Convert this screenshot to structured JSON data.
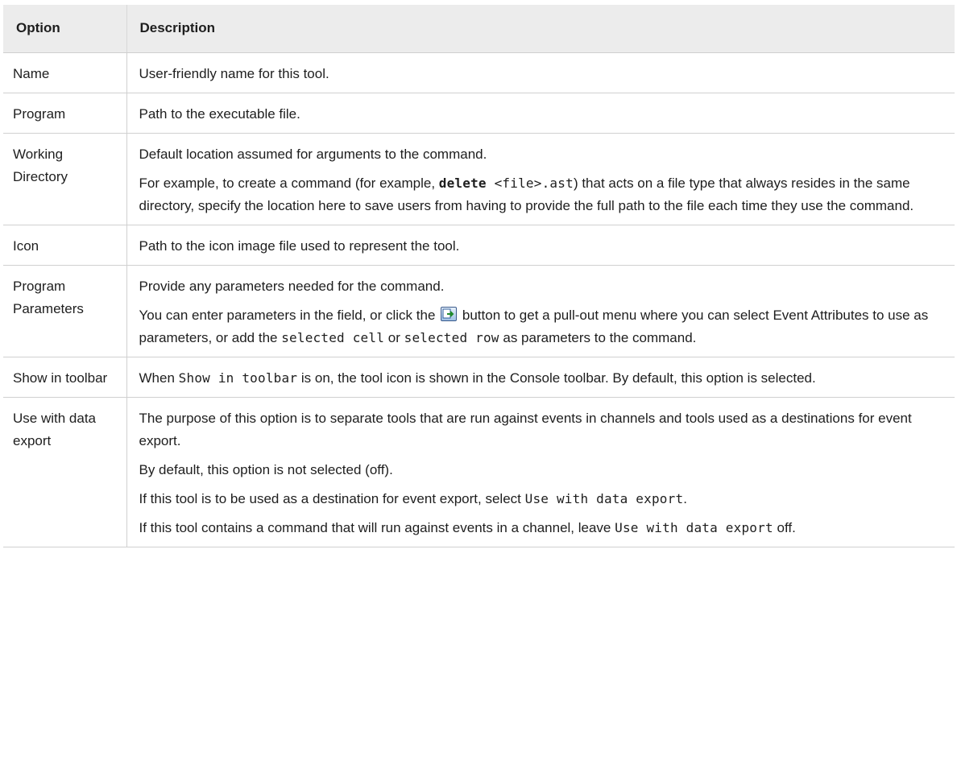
{
  "headers": {
    "option": "Option",
    "description": "Description"
  },
  "rows": {
    "name": {
      "option": "Name",
      "p1": "User-friendly name for this tool."
    },
    "program": {
      "option": "Program",
      "p1": "Path to the executable file."
    },
    "working_directory": {
      "option": "Working Directory",
      "p1": "Default location assumed for arguments to the command.",
      "p2_pre": "For example, to create a command (for example, ",
      "p2_code_bold": "delete",
      "p2_code": " <file>.ast",
      "p2_post": ") that acts on a file type that always resides in the same directory, specify the location here to save users from having to provide the full path to the file each time they use the command."
    },
    "icon": {
      "option": "Icon",
      "p1": "Path to the icon image file used to represent the tool."
    },
    "program_parameters": {
      "option": "Program Parameters",
      "p1": "Provide any parameters needed for the command.",
      "p2_pre": "You can enter parameters in the field, or click the",
      "p2_mid": "button to get a pull-out menu where you can select Event Attributes to use as parameters, or add the",
      "p2_code1": "selected cell",
      "p2_or": "or",
      "p2_code2": "selected row",
      "p2_post": "as parameters to the command.",
      "button_icon": "pull-out-menu-icon"
    },
    "show_in_toolbar": {
      "option": "Show in toolbar",
      "p1_pre": "When",
      "p1_code": "Show in toolbar",
      "p1_post": "is on, the tool icon is shown in the Console toolbar. By default, this option is selected."
    },
    "use_with_data_export": {
      "option": "Use with data export",
      "p1": "The purpose of this option is to separate tools that are run against events in channels and tools used as a destinations for event export.",
      "p2": "By default, this option is not selected (off).",
      "p3_pre": "If this tool is to be used as a destination for event export, select",
      "p3_code": "Use with data export",
      "p3_post": ".",
      "p4_pre": "If this tool contains a command that will run against events in a channel, leave",
      "p4_code": "Use with data export",
      "p4_post": "off."
    }
  }
}
